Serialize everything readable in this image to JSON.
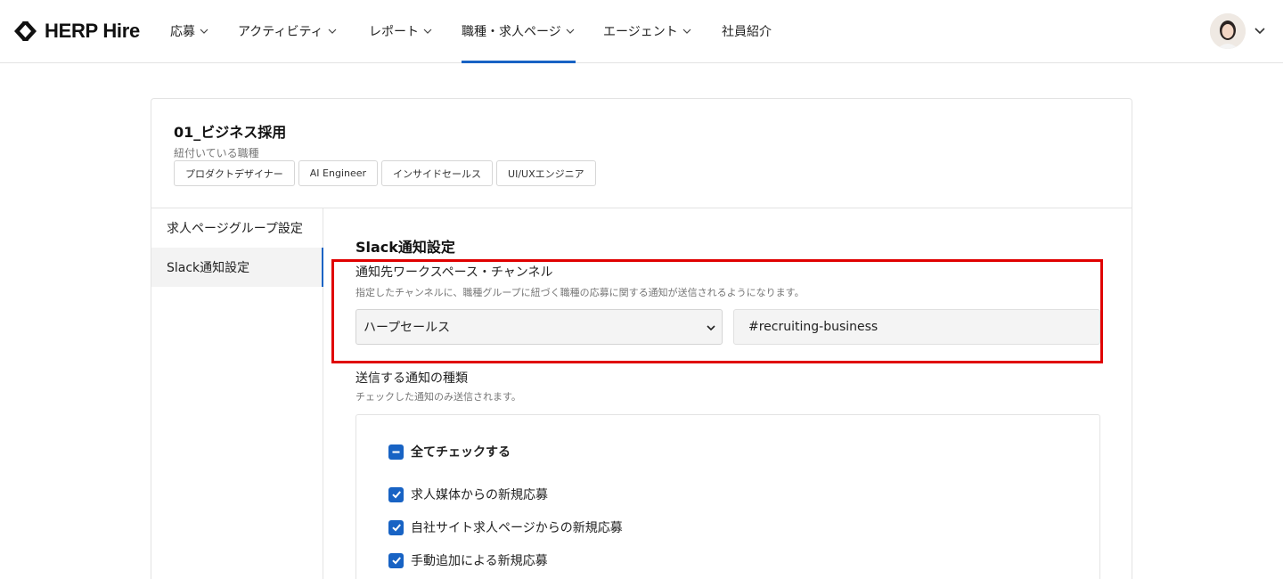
{
  "header": {
    "brand": "HERP Hire",
    "nav": [
      {
        "label": "応募",
        "has_dropdown": true
      },
      {
        "label": "アクティビティ",
        "has_dropdown": true
      },
      {
        "label": "レポート",
        "has_dropdown": true
      },
      {
        "label": "職種・求人ページ",
        "has_dropdown": true,
        "active": true
      },
      {
        "label": "エージェント",
        "has_dropdown": true
      },
      {
        "label": "社員紹介",
        "has_dropdown": false
      }
    ],
    "accent_color": "#1863c4"
  },
  "group": {
    "title": "01_ビジネス採用",
    "linked_label": "紐付いている職種",
    "tags": [
      "プロダクトデザイナー",
      "AI Engineer",
      "インサイドセールス",
      "UI/UXエンジニア"
    ]
  },
  "sidebar": {
    "items": [
      {
        "label": "求人ページグループ設定",
        "active": false
      },
      {
        "label": "Slack通知設定",
        "active": true
      }
    ]
  },
  "slack": {
    "section_title": "Slack通知設定",
    "destination_label": "通知先ワークスペース・チャンネル",
    "destination_help": "指定したチャンネルに、職種グループに紐づく職種の応募に関する通知が送信されるようになります。",
    "workspace_value": "ハープセールス",
    "channel_value": "#recruiting-business",
    "types_label": "送信する通知の種類",
    "types_help": "チェックした通知のみ送信されます。",
    "check_all_label": "全てチェックする",
    "check_all_state": "indeterminate",
    "options": [
      {
        "label": "求人媒体からの新規応募",
        "checked": true
      },
      {
        "label": "自社サイト求人ページからの新規応募",
        "checked": true
      },
      {
        "label": "手動追加による新規応募",
        "checked": true
      }
    ],
    "highlight_color": "#e00000"
  }
}
